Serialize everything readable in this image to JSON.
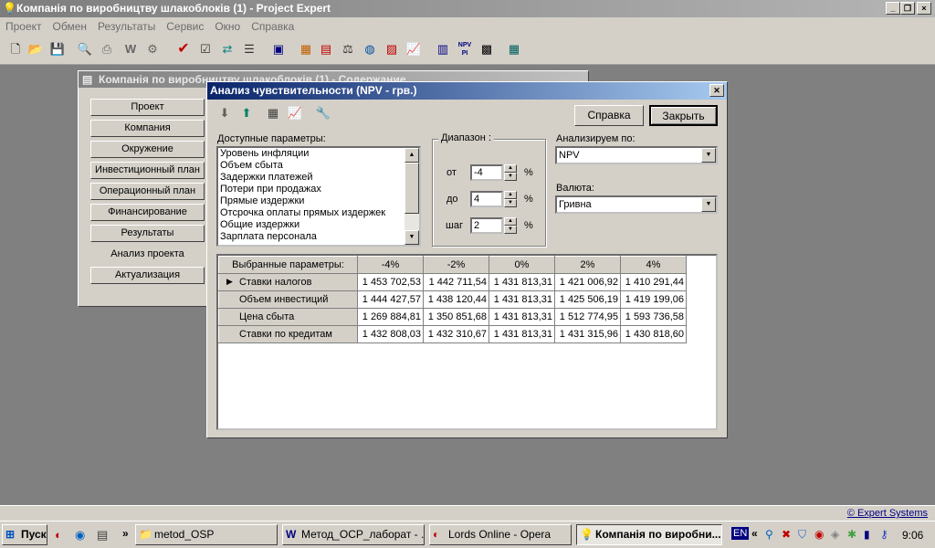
{
  "app": {
    "title": "Компанія по виробництву шлакоблоків (1) - Project Expert",
    "window_buttons": [
      "_",
      "❐",
      "×"
    ]
  },
  "menu": [
    "Проект",
    "Обмен",
    "Результаты",
    "Сервис",
    "Окно",
    "Справка"
  ],
  "toolbar_icons": [
    "new-icon",
    "open-icon",
    "save-icon",
    "preview-icon",
    "print-icon",
    "word-icon",
    "settings-icon",
    "check-icon",
    "checklist-icon",
    "refresh-icon",
    "list-icon",
    "report-icon",
    "table-icon",
    "chart-icon",
    "balance-icon",
    "globe-icon",
    "document-icon",
    "graph-icon",
    "grid-icon",
    "npv-icon",
    "calc-icon",
    "building-icon"
  ],
  "bg_window": {
    "title": "Компанія по виробництву шлакоблоків (1) - Содержание",
    "nav": [
      "Проект",
      "Компания",
      "Окружение",
      "Инвестиционный план",
      "Операционный план",
      "Финансирование",
      "Результаты",
      "Анализ проекта",
      "Актуализация"
    ],
    "active_index": 7
  },
  "dialog": {
    "title": "Анализ чувствительности (NPV - грв.)",
    "help_button": "Справка",
    "close_button": "Закрыть",
    "available_label": "Доступные параметры:",
    "available_params": [
      "Уровень инфляции",
      "Объем сбыта",
      "Задержки платежей",
      "Потери при продажах",
      "Прямые издержки",
      "Отсрочка оплаты прямых издержек",
      "Общие издержки",
      "Зарплата персонала"
    ],
    "range_label": "Диапазон :",
    "from_label": "от",
    "from_value": "-4",
    "to_label": "до",
    "to_value": "4",
    "step_label": "шаг",
    "step_value": "2",
    "percent": "%",
    "analyze_by_label": "Анализируем по:",
    "analyze_by_value": "NPV",
    "currency_label": "Валюта:",
    "currency_value": "Гривна",
    "table": {
      "corner": "Выбранные параметры:",
      "columns": [
        "-4%",
        "-2%",
        "0%",
        "2%",
        "4%"
      ],
      "rows": [
        {
          "name": "Ставки налогов",
          "values": [
            "1 453 702,53",
            "1 442 711,54",
            "1 431 813,31",
            "1 421 006,92",
            "1 410 291,44"
          ]
        },
        {
          "name": "Объем инвестиций",
          "values": [
            "1 444 427,57",
            "1 438 120,44",
            "1 431 813,31",
            "1 425 506,19",
            "1 419 199,06"
          ]
        },
        {
          "name": "Цена сбыта",
          "values": [
            "1 269 884,81",
            "1 350 851,68",
            "1 431 813,31",
            "1 512 774,95",
            "1 593 736,58"
          ]
        },
        {
          "name": "Ставки по кредитам",
          "values": [
            "1 432 808,03",
            "1 432 310,67",
            "1 431 813,31",
            "1 431 315,96",
            "1 430 818,60"
          ]
        }
      ]
    }
  },
  "status": {
    "link": "© Expert Systems"
  },
  "taskbar": {
    "start": "Пуск",
    "chevron": "»",
    "tasks": [
      {
        "label": "metod_OSP",
        "icon": "folder-icon"
      },
      {
        "label": "Метод_ОСР_лаборат - ...",
        "icon": "word-icon"
      },
      {
        "label": "Lords Online - Opera",
        "icon": "opera-icon"
      },
      {
        "label": "Компанія по виробни...",
        "icon": "bulb-icon"
      }
    ],
    "lang": "EN",
    "tray_chevron": "«",
    "clock": "9:06"
  }
}
